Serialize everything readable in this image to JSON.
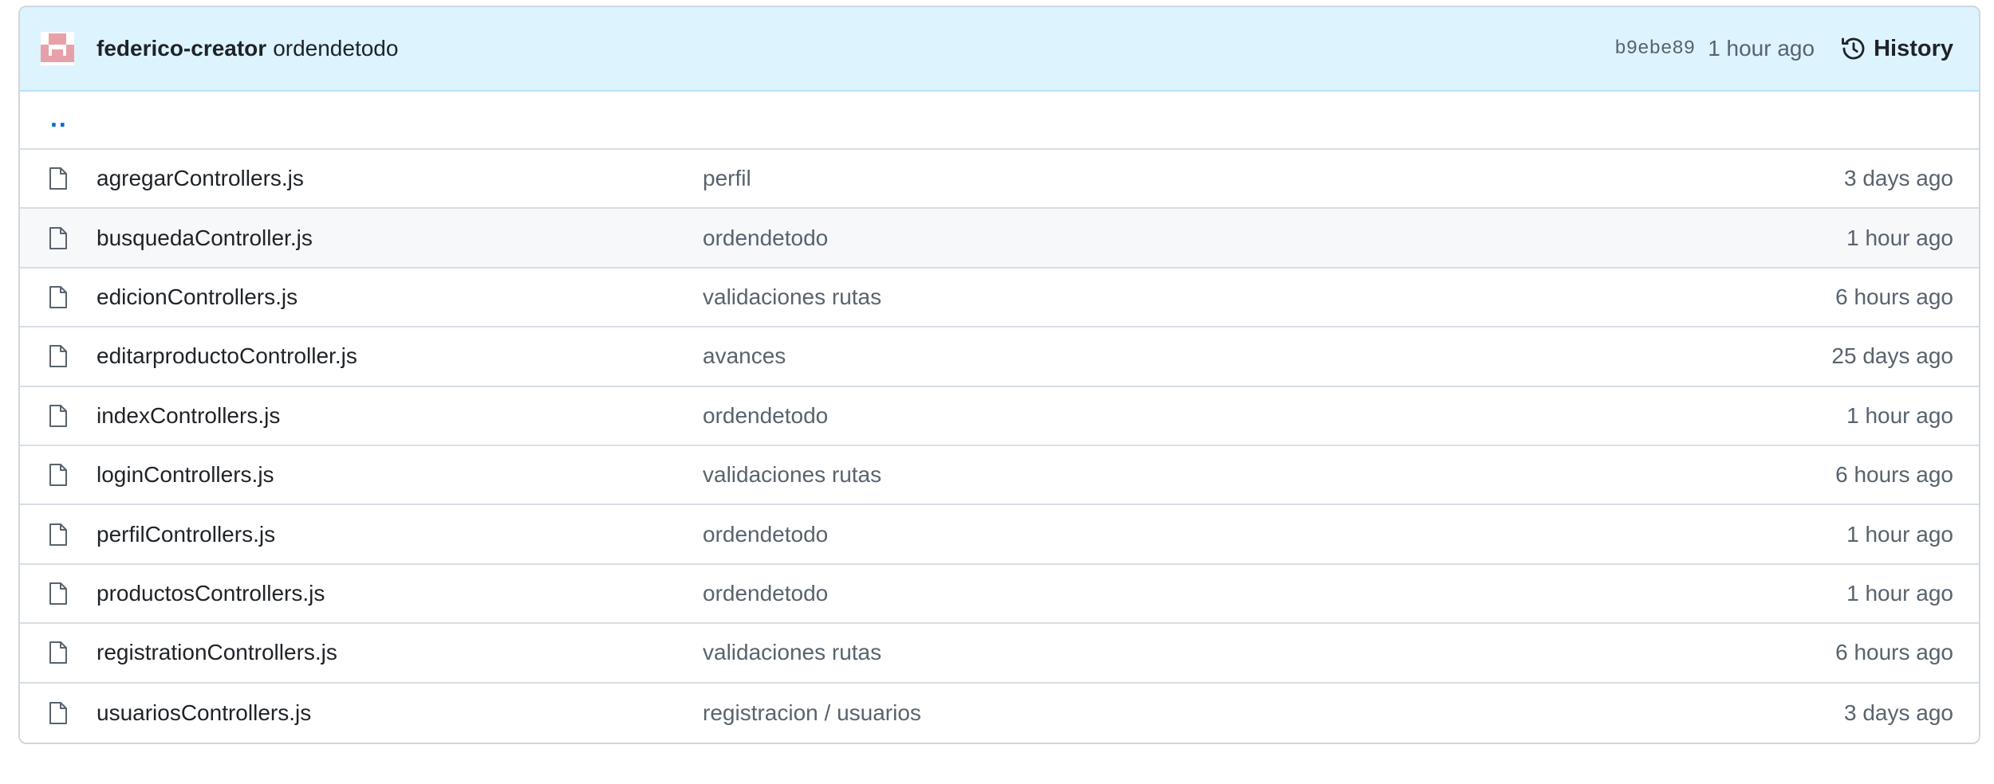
{
  "latest_commit": {
    "author": "federico-creator",
    "message": "ordendetodo",
    "sha": "b9ebe89",
    "time": "1 hour ago",
    "history_label": "History"
  },
  "parent_dir": "..",
  "files": [
    {
      "name": "agregarControllers.js",
      "message": "perfil",
      "age": "3 days ago"
    },
    {
      "name": "busquedaController.js",
      "message": "ordendetodo",
      "age": "1 hour ago"
    },
    {
      "name": "edicionControllers.js",
      "message": "validaciones rutas",
      "age": "6 hours ago"
    },
    {
      "name": "editarproductoController.js",
      "message": "avances",
      "age": "25 days ago"
    },
    {
      "name": "indexControllers.js",
      "message": "ordendetodo",
      "age": "1 hour ago"
    },
    {
      "name": "loginControllers.js",
      "message": "validaciones rutas",
      "age": "6 hours ago"
    },
    {
      "name": "perfilControllers.js",
      "message": "ordendetodo",
      "age": "1 hour ago"
    },
    {
      "name": "productosControllers.js",
      "message": "ordendetodo",
      "age": "1 hour ago"
    },
    {
      "name": "registrationControllers.js",
      "message": "validaciones rutas",
      "age": "6 hours ago"
    },
    {
      "name": "usuariosControllers.js",
      "message": "registracion / usuarios",
      "age": "3 days ago"
    }
  ],
  "icons": {
    "avatar": "identicon-avatar",
    "history": "history-clock-icon",
    "file": "file-icon"
  },
  "colors": {
    "commit_bar_bg": "#ddf4ff",
    "link": "#0969da",
    "avatar": "#e8a0a8",
    "hover_row": "#f6f8fa"
  }
}
